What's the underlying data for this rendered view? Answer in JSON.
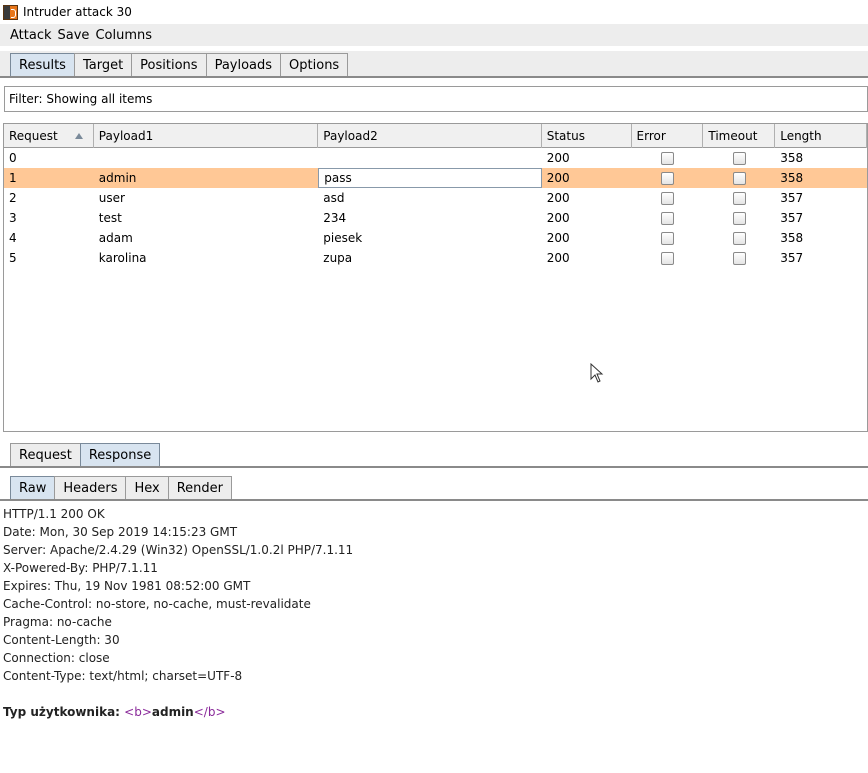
{
  "window": {
    "title": "Intruder attack 30"
  },
  "menu": [
    "Attack",
    "Save",
    "Columns"
  ],
  "main_tabs": [
    "Results",
    "Target",
    "Positions",
    "Payloads",
    "Options"
  ],
  "filter": {
    "label": "Filter: Showing all items"
  },
  "table": {
    "columns": [
      "Request",
      "Payload1",
      "Payload2",
      "Status",
      "Error",
      "Timeout",
      "Length"
    ],
    "sorted_column": "Request",
    "rows": [
      {
        "request": "0",
        "payload1": "",
        "payload2": "",
        "status": "200",
        "error": false,
        "timeout": false,
        "length": "358",
        "selected": false
      },
      {
        "request": "1",
        "payload1": "admin",
        "payload2": "pass",
        "status": "200",
        "error": false,
        "timeout": false,
        "length": "358",
        "selected": true
      },
      {
        "request": "2",
        "payload1": "user",
        "payload2": "asd",
        "status": "200",
        "error": false,
        "timeout": false,
        "length": "357",
        "selected": false
      },
      {
        "request": "3",
        "payload1": "test",
        "payload2": "234",
        "status": "200",
        "error": false,
        "timeout": false,
        "length": "357",
        "selected": false
      },
      {
        "request": "4",
        "payload1": "adam",
        "payload2": "piesek",
        "status": "200",
        "error": false,
        "timeout": false,
        "length": "358",
        "selected": false
      },
      {
        "request": "5",
        "payload1": "karolina",
        "payload2": "zupa",
        "status": "200",
        "error": false,
        "timeout": false,
        "length": "357",
        "selected": false
      }
    ]
  },
  "rr_tabs": [
    "Request",
    "Response"
  ],
  "view_tabs": [
    "Raw",
    "Headers",
    "Hex",
    "Render"
  ],
  "response": {
    "headers": [
      "HTTP/1.1 200 OK",
      "Date: Mon, 30 Sep 2019 14:15:23 GMT",
      "Server: Apache/2.4.29 (Win32) OpenSSL/1.0.2l PHP/7.1.11",
      "X-Powered-By: PHP/7.1.11",
      "Expires: Thu, 19 Nov 1981 08:52:00 GMT",
      "Cache-Control: no-store, no-cache, must-revalidate",
      "Pragma: no-cache",
      "Content-Length: 30",
      "Connection: close",
      "Content-Type: text/html; charset=UTF-8"
    ],
    "body_label": "Typ użytkownika: ",
    "body_tag_open": "<b>",
    "body_value": "admin",
    "body_tag_close": "</b>"
  },
  "colors": {
    "selected_row": "#ffc896",
    "active_tab": "#d8e4f0",
    "html_tag": "#8a2a9a"
  }
}
